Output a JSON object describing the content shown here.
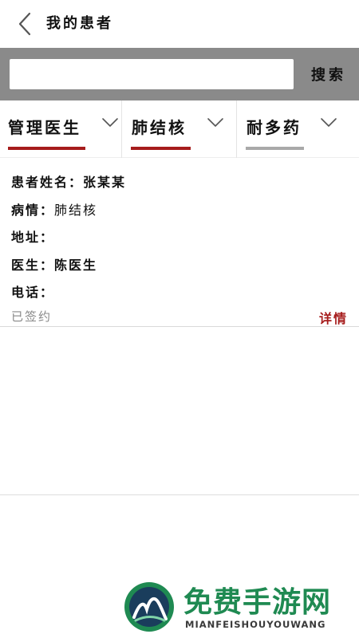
{
  "header": {
    "title": "我的患者",
    "back_icon": "chevron-left-icon"
  },
  "search": {
    "value": "",
    "placeholder": "",
    "button_label": "搜索"
  },
  "filters": [
    {
      "label": "管理医生",
      "icon": "chevron-down-icon",
      "underline_color": "#a61c1c"
    },
    {
      "label": "肺结核",
      "icon": "chevron-down-icon",
      "underline_color": "#a61c1c"
    },
    {
      "label": "耐多药",
      "icon": "chevron-down-icon",
      "underline_color": "#a9a9a9"
    }
  ],
  "patient": {
    "name_label": "患者姓名：",
    "name_value": "张某某",
    "condition_label": "病情：",
    "condition_value": "肺结核",
    "address_label": "地址：",
    "address_value": "",
    "doctor_label": "医生：",
    "doctor_value": "陈医生",
    "phone_label": "电话：",
    "phone_value": "",
    "status": "已签约",
    "details_label": "详情"
  },
  "watermark": {
    "name": "免费手游网",
    "sub": "MIANFEISHOUYOUWANG"
  },
  "colors": {
    "accent": "#a61c1c",
    "search_bar": "#8a8a8a",
    "muted_underline": "#a9a9a9",
    "watermark_green": "#1f8a52"
  }
}
